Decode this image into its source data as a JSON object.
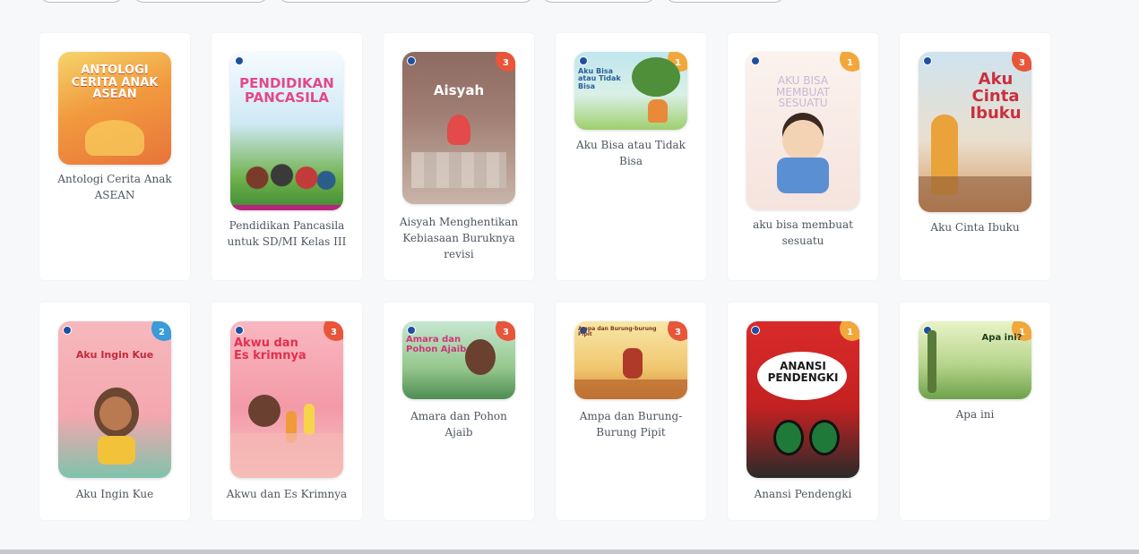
{
  "books": [
    {
      "title": "Antologi Cerita Anak ASEAN",
      "cover_text": "ANTOLOGI CERITA ANAK ASEAN",
      "grade": ""
    },
    {
      "title": "Pendidikan Pancasila untuk SD/MI Kelas III",
      "cover_text": "PENDIDIKAN PANCASILA",
      "grade": ""
    },
    {
      "title": "Aisyah Menghentikan Kebiasaan Buruknya revisi",
      "cover_text": "Aisyah",
      "grade": "3"
    },
    {
      "title": "Aku Bisa atau Tidak Bisa",
      "cover_text": "Aku Bisa atau Tidak Bisa",
      "grade": "1"
    },
    {
      "title": "aku bisa membuat sesuatu",
      "cover_text": "AKU BISA MEMBUAT SESUATU",
      "grade": "1"
    },
    {
      "title": "Aku Cinta Ibuku",
      "cover_text": "Aku Cinta Ibuku",
      "grade": "3"
    },
    {
      "title": "Aku Ingin Kue",
      "cover_text": "Aku Ingin Kue",
      "grade": "2"
    },
    {
      "title": "Akwu dan Es Krimnya",
      "cover_text": "Akwu dan Es krimnya",
      "grade": "3"
    },
    {
      "title": "Amara dan Pohon Ajaib",
      "cover_text": "Amara dan Pohon Ajaib",
      "grade": "3"
    },
    {
      "title": "Ampa dan Burung-Burung Pipit",
      "cover_text": "Ampa dan Burung-burung Pipit",
      "grade": "3"
    },
    {
      "title": "Anansi Pendengki",
      "cover_text": "ANANSI PENDENGKI",
      "grade": "1"
    },
    {
      "title": "Apa ini",
      "cover_text": "Apa ini?",
      "grade": "1"
    }
  ],
  "colors": {
    "grade_orange": "#e8553a",
    "grade_yellow": "#f2a73b",
    "grade_blue": "#3b9ad9"
  }
}
